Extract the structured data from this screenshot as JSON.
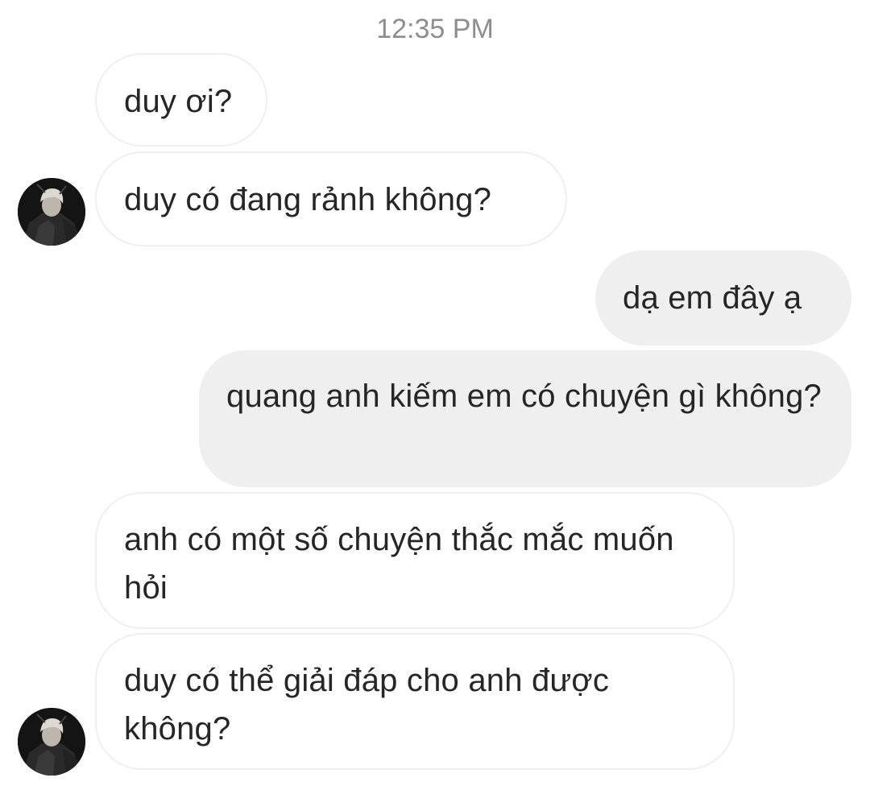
{
  "chat": {
    "timestamp": "12:35 PM",
    "messages": [
      {
        "sender": "other",
        "text": "duy ơi?"
      },
      {
        "sender": "other",
        "text": "duy có đang rảnh không?"
      },
      {
        "sender": "me",
        "text": "dạ em đây ạ"
      },
      {
        "sender": "me",
        "text": "quang anh kiếm em có chuyện gì không?"
      },
      {
        "sender": "other",
        "text": "anh có một số chuyện thắc mắc muốn hỏi"
      },
      {
        "sender": "other",
        "text": "duy có thể giải đáp cho anh được không?"
      }
    ]
  },
  "avatar": {
    "icon": "profile-photo",
    "background_color": "#141414",
    "hair_color": "#d9d6d0"
  },
  "colors": {
    "incoming_bubble": "#ffffff",
    "incoming_border": "#efefef",
    "outgoing_bubble": "#efefef",
    "text": "#262626",
    "timestamp": "#8e8e8e"
  }
}
